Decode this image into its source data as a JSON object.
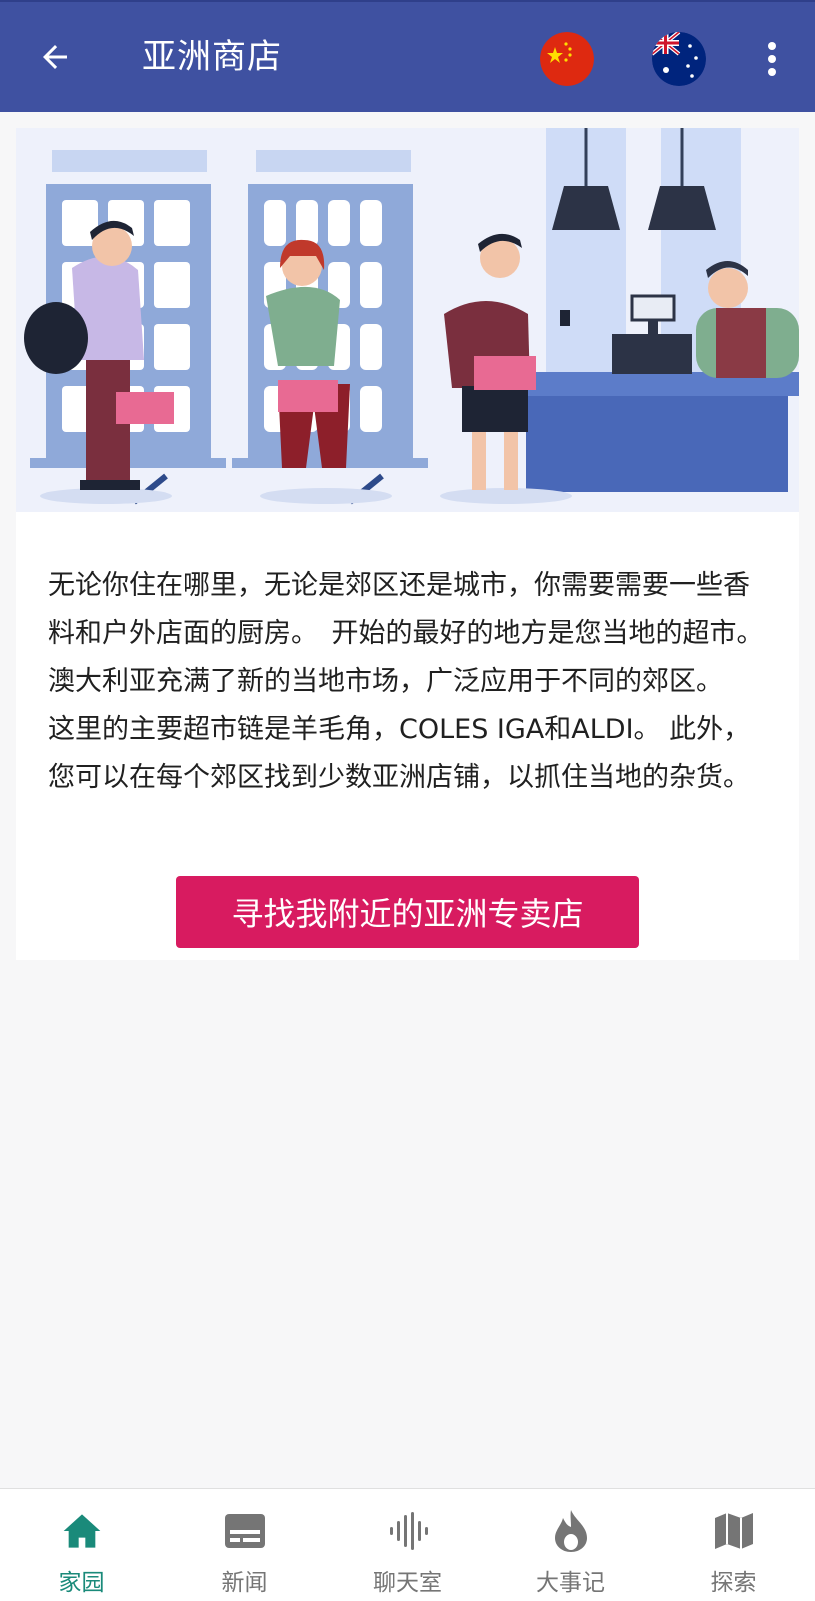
{
  "app": {
    "title": "亚洲商店"
  },
  "header": {
    "back_icon": "arrow-left-icon",
    "flags": [
      {
        "name": "china-flag",
        "colors": [
          "#de2910",
          "#ffde00"
        ]
      },
      {
        "name": "australia-flag",
        "colors": [
          "#00247d",
          "#cf142b",
          "#ffffff"
        ]
      }
    ],
    "menu_icon": "more-vertical-icon"
  },
  "content": {
    "paragraph": "无论你住在哪里，无论是郊区还是城市，你需要需要一些香料和户外店面的厨房。　开始的最好的地方是您当地的超市。　　澳大利亚充满了新的当地市场，广泛应用于不同的郊区。　　这里的主要超市链是羊毛角，COLES IGA和ALDI。 此外，您可以在每个郊区找到少数亚洲店铺，以抓住当地的杂货。",
    "cta_label": "寻找我附近的亚洲专卖店"
  },
  "bottom_nav": {
    "items": [
      {
        "label": "家园",
        "icon": "home-icon",
        "active": true
      },
      {
        "label": "新闻",
        "icon": "news-icon",
        "active": false
      },
      {
        "label": "聊天室",
        "icon": "audio-wave-icon",
        "active": false
      },
      {
        "label": "大事记",
        "icon": "flame-icon",
        "active": false
      },
      {
        "label": "探索",
        "icon": "map-icon",
        "active": false
      }
    ]
  },
  "colors": {
    "app_bar": "#3f51a1",
    "cta": "#d81b60",
    "active_nav": "#1a8a7a",
    "inactive_nav": "#757575"
  }
}
